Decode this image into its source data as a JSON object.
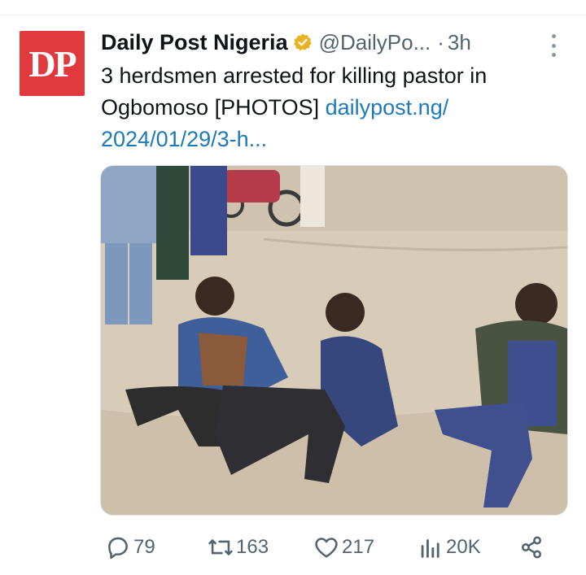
{
  "tweet": {
    "author_name": "Daily Post Nigeria",
    "avatar_text": "DP",
    "handle": "@DailyPo...",
    "separator": "·",
    "time": "3h",
    "text": "3 herdsmen arrested for killing pastor in Ogbomoso [PHOTOS] ",
    "link_text": "dailypost.ng/\n2024/01/29/3-h...",
    "link_line1": "dailypost.ng/",
    "link_line2": "2024/01/29/3-h..."
  },
  "actions": {
    "reply": {
      "icon": "reply-icon",
      "count": "79"
    },
    "retweet": {
      "icon": "retweet-icon",
      "count": "163"
    },
    "like": {
      "icon": "heart-icon",
      "count": "217"
    },
    "views": {
      "icon": "views-chart-icon",
      "count": "20K"
    },
    "share": {
      "icon": "share-icon"
    }
  },
  "colors": {
    "avatar_bg": "#e03a3e",
    "link": "#1d7ab8",
    "muted": "#536471",
    "verified_badge": "#e8b321"
  }
}
